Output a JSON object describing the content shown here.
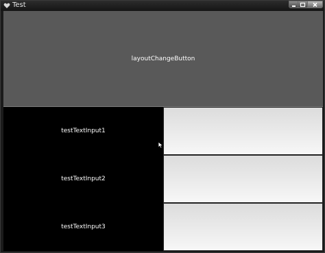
{
  "window": {
    "title": "Test",
    "app_icon": "heart-icon",
    "controls": [
      "minimize-icon",
      "maximize-icon",
      "close-icon"
    ]
  },
  "layout_button": {
    "label": "layoutChangeButton"
  },
  "rows": [
    {
      "label": "testTextInput1",
      "value": ""
    },
    {
      "label": "testTextInput2",
      "value": ""
    },
    {
      "label": "testTextInput3",
      "value": ""
    }
  ],
  "colors": {
    "client_background": "#000000",
    "button_background": "#595959",
    "input_top": "#dcdcdc",
    "input_bottom": "#f7f7f7",
    "label_text": "#ffffff"
  },
  "cursor": "arrow-cursor-icon"
}
